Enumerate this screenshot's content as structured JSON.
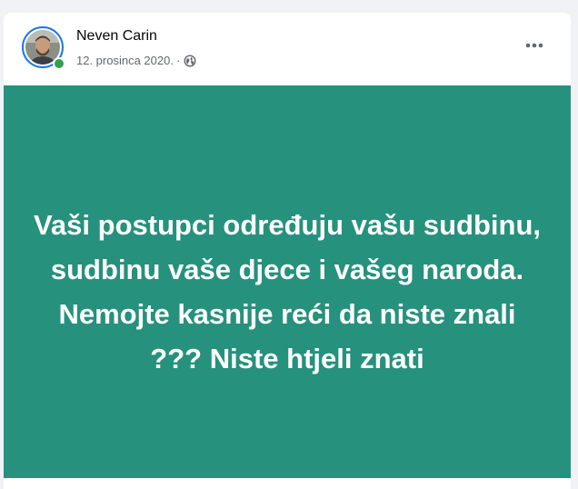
{
  "post": {
    "author_name": "Neven Carin",
    "timestamp": "12. prosinca 2020.",
    "separator": "·",
    "audience_icon": "globe-icon",
    "more_icon": "more-options-icon",
    "status_color": "#31a24c",
    "background_color": "#26917d",
    "text": "Vaši postupci određuju vašu sudbinu, sudbinu vaše djece i vašeg naroda. Nemojte kasnije reći da niste znali ??? Niste htjeli znati"
  }
}
